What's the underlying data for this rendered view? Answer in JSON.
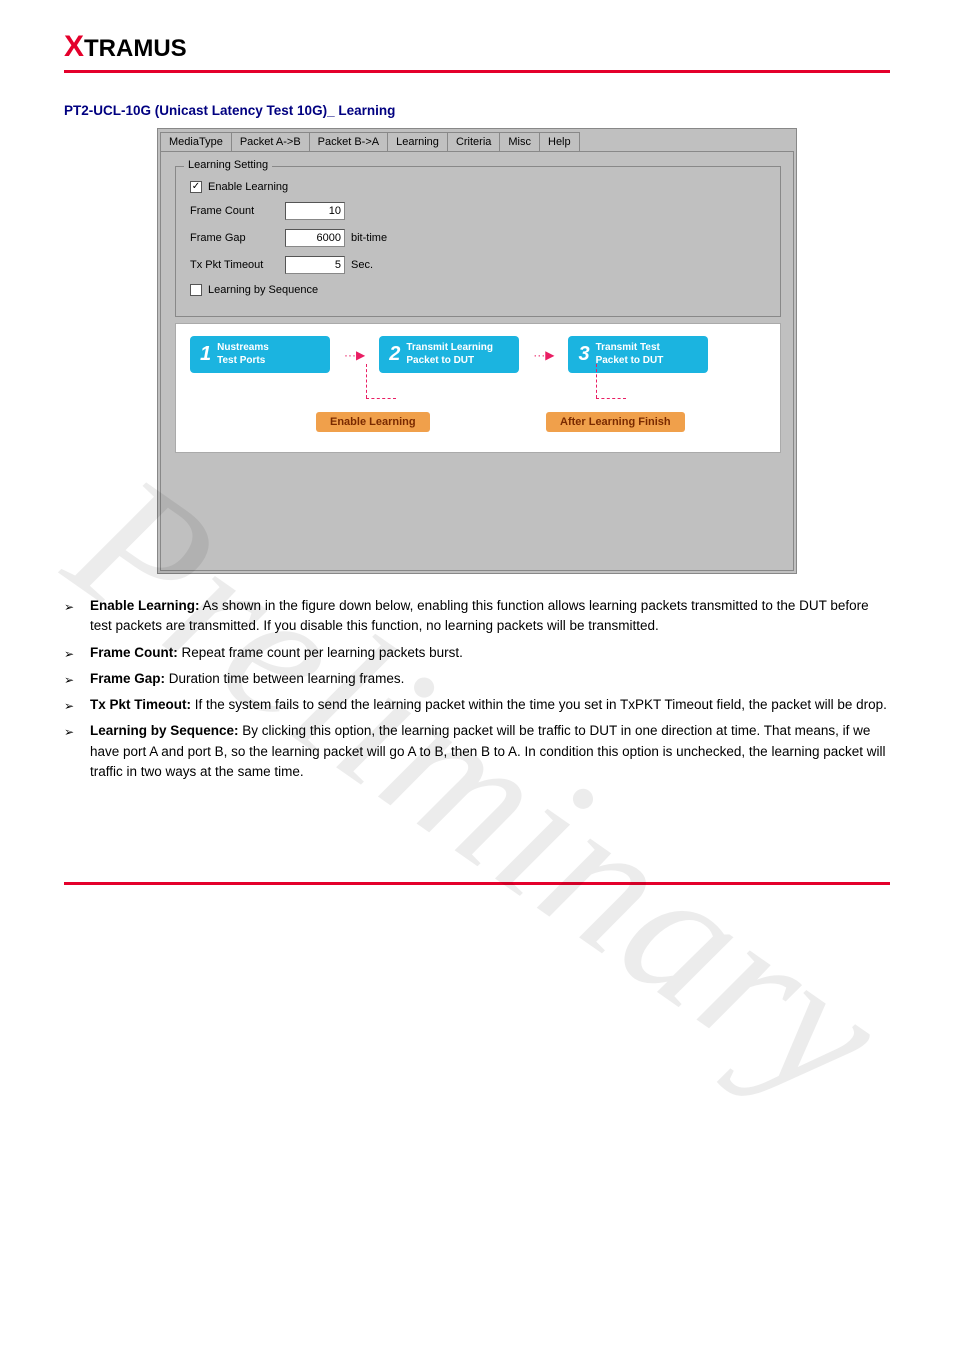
{
  "logo": {
    "x": "X",
    "rest": "TRAMUS"
  },
  "section_title": "PT2-UCL-10G (Unicast Latency Test 10G)_ Learning",
  "tabs": [
    "MediaType",
    "Packet A->B",
    "Packet B->A",
    "Learning",
    "Criteria",
    "Misc",
    "Help"
  ],
  "active_tab": 3,
  "groupbox": {
    "title": "Learning Setting",
    "enable_learning": {
      "label": "Enable Learning",
      "checked": true
    },
    "frame_count": {
      "label": "Frame Count",
      "value": "10",
      "unit": ""
    },
    "frame_gap": {
      "label": "Frame Gap",
      "value": "6000",
      "unit": "bit-time"
    },
    "tx_timeout": {
      "label": "Tx Pkt Timeout",
      "value": "5",
      "unit": "Sec."
    },
    "learning_by_sequence": {
      "label": "Learning by Sequence",
      "checked": false
    }
  },
  "diagram": {
    "box1": {
      "num": "1",
      "line1": "Nustreams",
      "line2": "Test Ports"
    },
    "box2": {
      "num": "2",
      "line1": "Transmit Learning",
      "line2": "Packet to DUT"
    },
    "box3": {
      "num": "3",
      "line1": "Transmit Test",
      "line2": "Packet to DUT"
    },
    "label1": "Enable Learning",
    "label2": "After Learning Finish"
  },
  "bullets": [
    {
      "bold": "Enable Learning:",
      "text": " As shown in the figure down below, enabling this function allows learning packets transmitted to the DUT before test packets are transmitted. If you disable this function, no learning packets will be transmitted."
    },
    {
      "bold": "Frame Count:",
      "text": " Repeat frame count per learning packets burst."
    },
    {
      "bold": "Frame Gap:",
      "text": " Duration time between learning frames."
    },
    {
      "bold": "Tx Pkt Timeout:",
      "text": " If the system fails to send the learning packet within the time you set in TxPKT Timeout field, the packet will be drop."
    },
    {
      "bold": "Learning by Sequence:",
      "text": " By clicking this option, the learning packet will be traffic to DUT in one direction at time. That means, if we have port A and port B, so the learning packet will go A to B, then B to A. In condition this option is unchecked, the learning packet will traffic in two ways at the same time."
    }
  ],
  "watermark": "Preliminary"
}
